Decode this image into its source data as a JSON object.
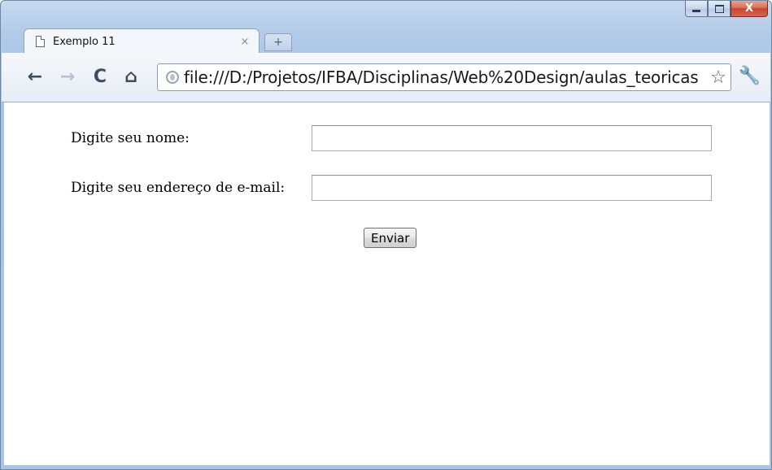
{
  "browser": {
    "tab": {
      "title": "Exemplo 11",
      "close_glyph": "×"
    },
    "new_tab_glyph": "+",
    "url": "file:///D:/Projetos/IFBA/Disciplinas/Web%20Design/aulas_teoricas",
    "window_controls": {
      "close_glyph": "X"
    },
    "icons": {
      "back": "back-arrow-icon",
      "forward": "forward-arrow-icon",
      "reload": "reload-icon",
      "home": "home-icon",
      "page": "globe-icon",
      "bookmark": "star-icon",
      "menu": "wrench-icon"
    }
  },
  "form": {
    "name_label": "Digite seu nome:",
    "name_value": "",
    "email_label": "Digite seu endereço de e-mail:",
    "email_value": "",
    "submit_label": "Enviar"
  },
  "colors": {
    "window_frame": "#aac4e4",
    "toolbar": "#eef2f8",
    "close_button": "#c8452e"
  }
}
